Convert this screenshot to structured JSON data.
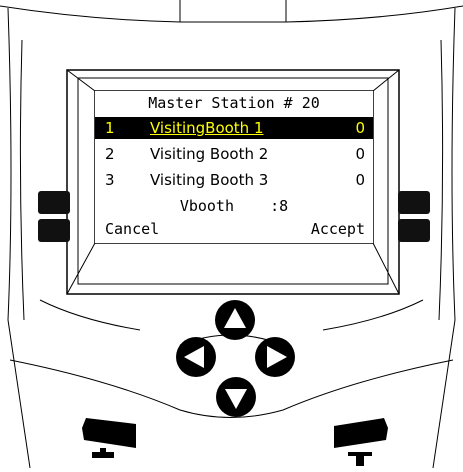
{
  "screen": {
    "title": "Master Station # 20",
    "rows": [
      {
        "num": "1",
        "name": "VisitingBooth 1",
        "value": "0",
        "selected": true
      },
      {
        "num": "2",
        "name": "Visiting Booth 2",
        "value": "0",
        "selected": false
      },
      {
        "num": "3",
        "name": "Visiting Booth 3",
        "value": "0",
        "selected": false
      }
    ],
    "vbooth": "Vbooth    :8",
    "softkeys": {
      "left": "Cancel",
      "right": "Accept"
    }
  },
  "icons": {
    "nav_up": "arrow-up-icon",
    "nav_down": "arrow-down-icon",
    "nav_left": "arrow-left-icon",
    "nav_right": "arrow-right-icon",
    "call_accept": "phone-hook-down-icon",
    "call_end": "phone-hook-up-icon"
  },
  "colors": {
    "selected_bg": "#000000",
    "selected_text": "#ffff00",
    "body": "#ffffff",
    "keys": "#111111"
  }
}
